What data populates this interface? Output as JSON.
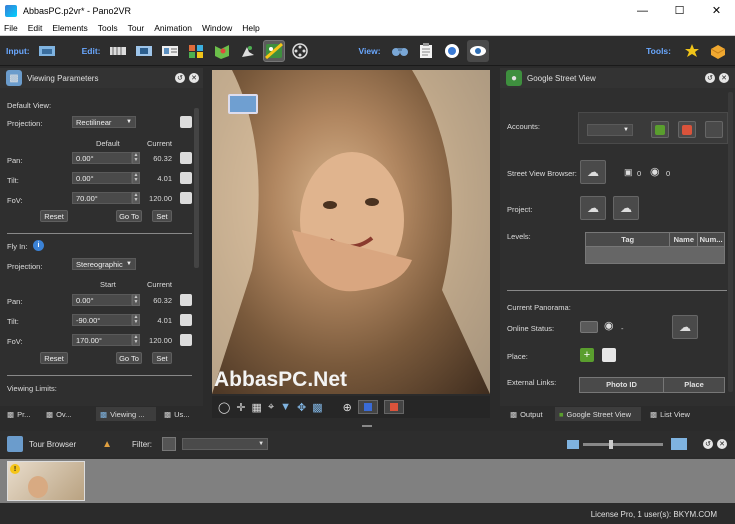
{
  "window": {
    "title": "AbbasPC.p2vr* - Pano2VR"
  },
  "menu": [
    "File",
    "Edit",
    "Elements",
    "Tools",
    "Tour",
    "Animation",
    "Window",
    "Help"
  ],
  "toolbar": {
    "input_label": "Input:",
    "edit_label": "Edit:",
    "view_label": "View:",
    "tools_label": "Tools:"
  },
  "viewing": {
    "title": "Viewing Parameters",
    "default_view": "Default View:",
    "projection_label": "Projection:",
    "projection": "Rectilinear",
    "col_default": "Default",
    "col_current": "Current",
    "pan_label": "Pan:",
    "pan": "0.00°",
    "pan_cur": "60.32",
    "tilt_label": "Tilt:",
    "tilt": "0.00°",
    "tilt_cur": "4.01",
    "fov_label": "FoV:",
    "fov": "70.00°",
    "fov_cur": "120.00",
    "reset": "Reset",
    "goto": "Go To",
    "set": "Set",
    "flyin": "Fly In:",
    "fly_projection": "Stereographic",
    "col_start": "Start",
    "fly_pan": "0.00°",
    "fly_pan_cur": "60.32",
    "fly_tilt": "-90.00°",
    "fly_tilt_cur": "4.01",
    "fly_fov": "170.00°",
    "fly_fov_cur": "120.00",
    "limits": "Viewing Limits:"
  },
  "left_tabs": [
    "Pr...",
    "Ov...",
    "Viewing ...",
    "Us..."
  ],
  "watermark": "AbbasPC.Net",
  "gsv": {
    "title": "Google Street View",
    "accounts": "Accounts:",
    "browser": "Street View Browser:",
    "photo_count": "0",
    "view_count": "0",
    "project": "Project:",
    "levels": "Levels:",
    "col_tag": "Tag",
    "col_name": "Name",
    "col_num": "Num...",
    "current_panorama": "Current Panorama:",
    "online_status": "Online Status:",
    "status_value": "-",
    "place": "Place:",
    "external_links": "External Links:",
    "col_photo_id": "Photo ID",
    "col_place": "Place"
  },
  "right_tabs": [
    "Output",
    "Google Street View",
    "List View"
  ],
  "tour": {
    "title": "Tour Browser",
    "filter_label": "Filter:"
  },
  "status": {
    "license": "License Pro, 1 user(s): BKYM.COM"
  },
  "colors": {
    "accent": "#6aa8ff",
    "panel": "#2f2f2f",
    "button_green": "#5a9e2e",
    "button_red": "#d9533b"
  }
}
